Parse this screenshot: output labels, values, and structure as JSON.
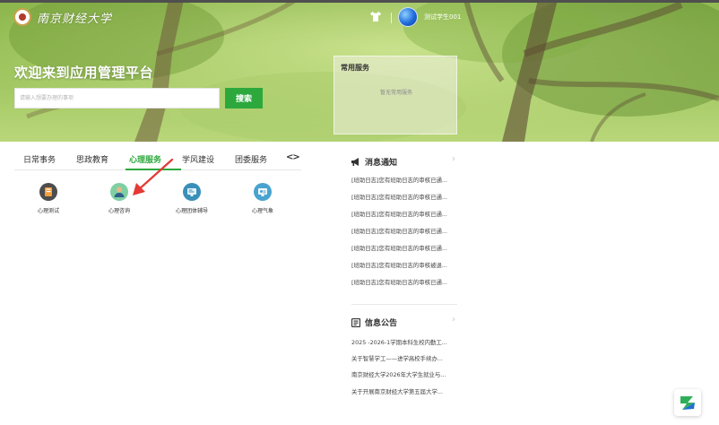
{
  "header": {
    "logo_text": "南京财经大学",
    "username": "测试学生001"
  },
  "hero": {
    "welcome": "欢迎来到应用管理平台",
    "search_placeholder": "请输入想要办理的事项",
    "search_button": "搜索"
  },
  "common_services": {
    "title": "常用服务",
    "empty_text": "暂无常用服务"
  },
  "tabs": {
    "items": [
      "日常事务",
      "思政教育",
      "心理服务",
      "学风建设",
      "团委服务"
    ],
    "active": "心理服务",
    "arrows": "<>"
  },
  "apps": [
    {
      "label": "心理测试",
      "icon": "notebook-icon"
    },
    {
      "label": "心理咨询",
      "icon": "user-icon"
    },
    {
      "label": "心理团体辅导",
      "icon": "monitor-icon"
    },
    {
      "label": "心理气象",
      "icon": "screen-icon"
    }
  ],
  "news": {
    "title": "消息通知",
    "items": [
      "[班助日志]您有班助日志的审核已通...",
      "[班助日志]您有班助日志的审核已通...",
      "[班助日志]您有班助日志的审核已通...",
      "[班助日志]您有班助日志的审核已通...",
      "[班助日志]您有班助日志的审核已通...",
      "[班助日志]您有班助日志的审核被退...",
      "[班助日志]您有班助日志的审核已通..."
    ]
  },
  "notices": {
    "title": "信息公告",
    "items": [
      "2025 -2026-1学期本科生校内勤工...",
      "关于智慧学工——进学高校手续办...",
      "南京财经大学2026年大学生就业与...",
      "关于开展南京财经大学第五届大学..."
    ]
  },
  "colors": {
    "accent_green": "#2da83d",
    "annotation_red": "#e53935"
  }
}
